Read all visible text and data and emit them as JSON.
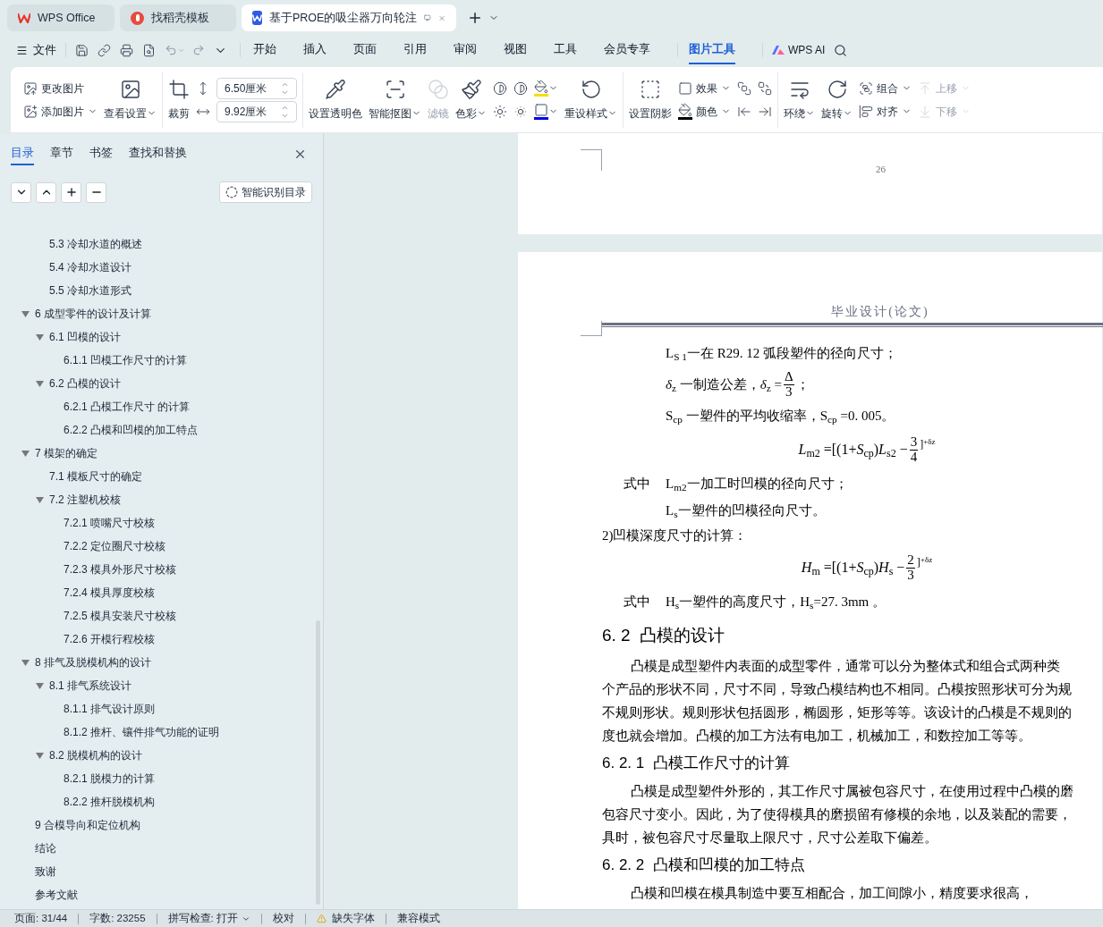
{
  "window_tabs": [
    {
      "label": "WPS Office",
      "selected": false
    },
    {
      "label": "找稻壳模板",
      "selected": false
    },
    {
      "label": "基于PROE的吸尘器万向轮注",
      "selected": true
    }
  ],
  "menu": {
    "file": "文件",
    "tabs": [
      {
        "label": "开始",
        "selected": false
      },
      {
        "label": "插入",
        "selected": false
      },
      {
        "label": "页面",
        "selected": false
      },
      {
        "label": "引用",
        "selected": false
      },
      {
        "label": "审阅",
        "selected": false
      },
      {
        "label": "视图",
        "selected": false
      },
      {
        "label": "工具",
        "selected": false
      },
      {
        "label": "会员专享",
        "selected": false
      },
      {
        "label": "图片工具",
        "selected": true
      }
    ],
    "ai": "WPS AI"
  },
  "ribbon": [
    {
      "columns": [
        [
          {
            "kind": "small",
            "label": "更改图片",
            "dropdown": false,
            "disabled": false
          },
          {
            "kind": "small",
            "label": "添加图片",
            "dropdown": true,
            "disabled": false
          }
        ],
        [
          {
            "kind": "large",
            "label": "查看设置",
            "dropdown": true,
            "disabled": false
          }
        ]
      ]
    },
    {
      "columns": [
        [
          {
            "kind": "large",
            "label": "裁剪",
            "dropdown": false,
            "disabled": false
          }
        ],
        [
          {
            "kind": "icon",
            "dropdown": false,
            "disabled": false
          },
          {
            "kind": "icon",
            "dropdown": false,
            "disabled": false
          }
        ],
        [
          {
            "kind": "field",
            "value": "6.50厘米"
          },
          {
            "kind": "field",
            "value": "9.92厘米"
          }
        ]
      ]
    },
    {
      "columns": [
        [
          {
            "kind": "large",
            "label": "设置透明色",
            "dropdown": false,
            "disabled": false
          }
        ],
        [
          {
            "kind": "large",
            "label": "智能抠图",
            "dropdown": true,
            "disabled": false
          }
        ],
        [
          {
            "kind": "large",
            "label": "滤镜",
            "dropdown": false,
            "disabled": true
          }
        ],
        [
          {
            "kind": "large",
            "label": "色彩",
            "dropdown": true,
            "disabled": false
          }
        ],
        [
          {
            "kind": "icon",
            "dropdown": false,
            "disabled": false
          },
          {
            "kind": "icon",
            "dropdown": false,
            "disabled": false
          }
        ],
        [
          {
            "kind": "icon",
            "dropdown": false,
            "disabled": false
          },
          {
            "kind": "icon",
            "dropdown": false,
            "disabled": false
          }
        ],
        [
          {
            "kind": "icon",
            "dropdown": true,
            "disabled": false
          },
          {
            "kind": "icon",
            "dropdown": true,
            "disabled": false
          }
        ],
        [
          {
            "kind": "large",
            "label": "重设样式",
            "dropdown": true,
            "disabled": false
          }
        ]
      ]
    },
    {
      "columns": [
        [
          {
            "kind": "large",
            "label": "设置阴影",
            "dropdown": false,
            "disabled": false
          }
        ],
        [
          {
            "kind": "small",
            "label": "效果",
            "dropdown": true,
            "disabled": false
          },
          {
            "kind": "small",
            "label": "颜色",
            "dropdown": true,
            "disabled": false
          }
        ],
        [
          {
            "kind": "icon",
            "dropdown": false,
            "disabled": false
          },
          {
            "kind": "icon",
            "dropdown": false,
            "disabled": false
          }
        ],
        [
          {
            "kind": "icon",
            "dropdown": false,
            "disabled": false
          },
          {
            "kind": "icon",
            "dropdown": false,
            "disabled": false
          }
        ]
      ]
    },
    {
      "columns": [
        [
          {
            "kind": "large",
            "label": "环绕",
            "dropdown": true,
            "disabled": false
          }
        ],
        [
          {
            "kind": "large",
            "label": "旋转",
            "dropdown": true,
            "disabled": false
          }
        ],
        [
          {
            "kind": "small",
            "label": "组合",
            "dropdown": true,
            "disabled": false
          },
          {
            "kind": "small",
            "label": "对齐",
            "dropdown": true,
            "disabled": false
          }
        ],
        [
          {
            "kind": "small",
            "label": "上移",
            "dropdown": true,
            "disabled": true
          },
          {
            "kind": "small",
            "label": "下移",
            "dropdown": true,
            "disabled": true
          }
        ]
      ]
    }
  ],
  "nav_panel": {
    "tabs": [
      {
        "label": "目录",
        "selected": true
      },
      {
        "label": "章节",
        "selected": false
      },
      {
        "label": "书签",
        "selected": false
      },
      {
        "label": "查找和替换",
        "selected": false
      }
    ],
    "smart_button": "智能识别目录",
    "continued_children": [
      {
        "label": "5.3 冷却水道的概述"
      },
      {
        "label": "5.4 冷却水道设计"
      },
      {
        "label": "5.5 冷却水道形式"
      }
    ],
    "toc": [
      {
        "label": "6 成型零件的设计及计算",
        "expanded": true,
        "children": [
          {
            "label": "6.1 凹模的设计",
            "expanded": true,
            "children": [
              {
                "label": "6.1.1 凹模工作尺寸的计算"
              }
            ]
          },
          {
            "label": "6.2 凸模的设计",
            "expanded": true,
            "children": [
              {
                "label": "6.2.1 凸模工作尺寸 的计算"
              },
              {
                "label": "6.2.2 凸模和凹模的加工特点"
              }
            ]
          }
        ]
      },
      {
        "label": "7 模架的确定",
        "expanded": true,
        "children": [
          {
            "label": "7.1 模板尺寸的确定"
          },
          {
            "label": "7.2 注塑机校核",
            "expanded": true,
            "children": [
              {
                "label": "7.2.1 喷嘴尺寸校核"
              },
              {
                "label": "7.2.2 定位圈尺寸校核"
              },
              {
                "label": "7.2.3 模具外形尺寸校核"
              },
              {
                "label": "7.2.4 模具厚度校核"
              },
              {
                "label": "7.2.5 模具安装尺寸校核"
              },
              {
                "label": "7.2.6 开模行程校核"
              }
            ]
          }
        ]
      },
      {
        "label": "8 排气及脱模机构的设计",
        "expanded": true,
        "children": [
          {
            "label": "8.1 排气系统设计",
            "expanded": true,
            "children": [
              {
                "label": "8.1.1 排气设计原则"
              },
              {
                "label": "8.1.2 推杆、镶件排气功能的证明"
              }
            ]
          },
          {
            "label": "8.2 脱模机构的设计",
            "expanded": true,
            "children": [
              {
                "label": "8.2.1 脱模力的计算"
              },
              {
                "label": "8.2.2 推杆脱模机构"
              }
            ]
          }
        ]
      },
      {
        "label": "9 合模导向和定位机构"
      },
      {
        "label": "结论"
      },
      {
        "label": "致谢"
      },
      {
        "label": "参考文献"
      }
    ]
  },
  "document": {
    "prev_page_number": "26",
    "header": "毕业设计(论文)",
    "blocks": [
      {
        "kind": "def",
        "text": "L$_{S 1}$一在 R29. 12 弧段塑件的径向尺寸；"
      },
      {
        "kind": "def_fraction",
        "before": "*δ*$_{z}$ 一制造公差，*δ*$_{z}$ =",
        "num": "Δ",
        "den": "3",
        "after": "；"
      },
      {
        "kind": "def",
        "text": "S$_{cp}$ 一塑件的平均收缩率，S$_{cp}$ =0. 005。"
      },
      {
        "kind": "formula",
        "before": "*L*$_{m2}$ =[(1+*S*$_{cp}$)*L*$_{s2}$ −",
        "num": "3",
        "den": "4",
        "after": "]$^{+δz}$"
      },
      {
        "kind": "def",
        "lead": "式中",
        "text": "L$_{m2}$一加工时凹模的径向尺寸；"
      },
      {
        "kind": "def",
        "text": "L$_{s}$一塑件的凹模径向尺寸。"
      },
      {
        "kind": "text",
        "text": "2)凹模深度尺寸的计算："
      },
      {
        "kind": "formula",
        "before": "*H*$_{m}$ =[(1+*S*$_{cp}$)*H*$_{s}$ −",
        "num": "2",
        "den": "3",
        "after": "]$^{+δz}$"
      },
      {
        "kind": "def",
        "lead": "式中",
        "text": "H$_{s}$一塑件的高度尺寸，H$_{s}$=27. 3mm 。"
      },
      {
        "kind": "heading",
        "text": "6. 2  凸模的设计"
      },
      {
        "kind": "paragraph",
        "lines": [
          "凸模是成型塑件内表面的成型零件，通常可以分为整体式和组合式两种类",
          "个产品的形状不同，尺寸不同，导致凸模结构也不相同。凸模按照形状可分为规",
          "不规则形状。规则形状包括圆形，椭圆形，矩形等等。该设计的凸模是不规则的",
          "度也就会增加。凸模的加工方法有电加工，机械加工，和数控加工等等。"
        ]
      },
      {
        "kind": "subheading",
        "text": "6. 2. 1  凸模工作尺寸的计算"
      },
      {
        "kind": "paragraph",
        "lines": [
          "凸模是成型塑件外形的，其工作尺寸属被包容尺寸，在使用过程中凸模的磨",
          "包容尺寸变小。因此，为了使得模具的磨损留有修模的余地，以及装配的需要，",
          "具时，被包容尺寸尽量取上限尺寸，尺寸公差取下偏差。"
        ]
      },
      {
        "kind": "subheading",
        "text": "6. 2. 2  凸模和凹模的加工特点"
      },
      {
        "kind": "paragraph",
        "lines": [
          "凸模和凹模在模具制造中要互相配合，加工间隙小，精度要求很高，"
        ]
      }
    ]
  },
  "status_bar": [
    {
      "kind": "text",
      "label": "页面: 31/44"
    },
    {
      "kind": "text",
      "label": "字数: 23255"
    },
    {
      "kind": "dropdown",
      "label": "拼写检查: 打开"
    },
    {
      "kind": "text",
      "label": "校对"
    },
    {
      "kind": "warning",
      "label": "缺失字体"
    },
    {
      "kind": "text",
      "label": "兼容模式"
    }
  ]
}
